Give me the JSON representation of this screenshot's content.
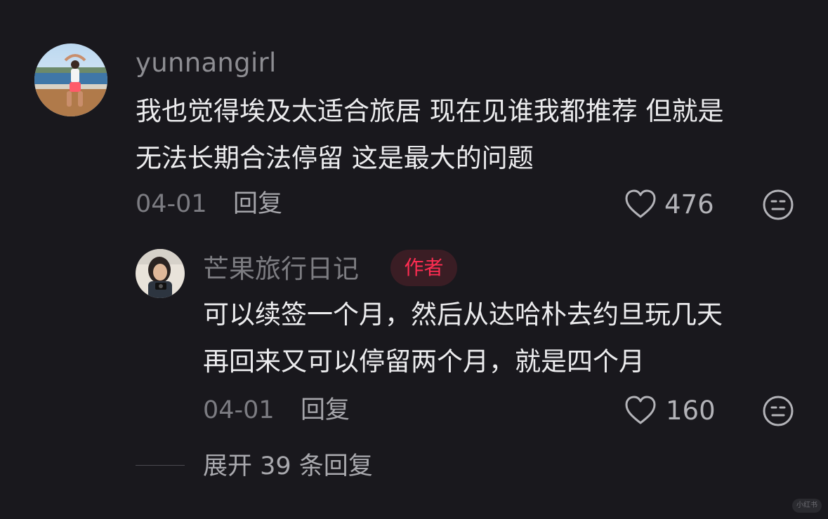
{
  "comment": {
    "username": "yunnangirl",
    "text": "我也觉得埃及太适合旅居 现在见谁我都推荐 但就是\n无法长期合法停留 这是最大的问题",
    "date": "04-01",
    "reply_label": "回复",
    "like_count": "476"
  },
  "reply": {
    "username": "芒果旅行日记",
    "badge": "作者",
    "text": "可以续签一个月，然后从达哈朴去约旦玩几天\n再回来又可以停留两个月，就是四个月",
    "date": "04-01",
    "reply_label": "回复",
    "like_count": "160"
  },
  "expand_replies": "展开 39 条回复",
  "watermark": "小红书",
  "colors": {
    "background": "#19181d",
    "accent": "#ff2d52"
  },
  "icons": [
    "heart-icon",
    "face-icon"
  ]
}
